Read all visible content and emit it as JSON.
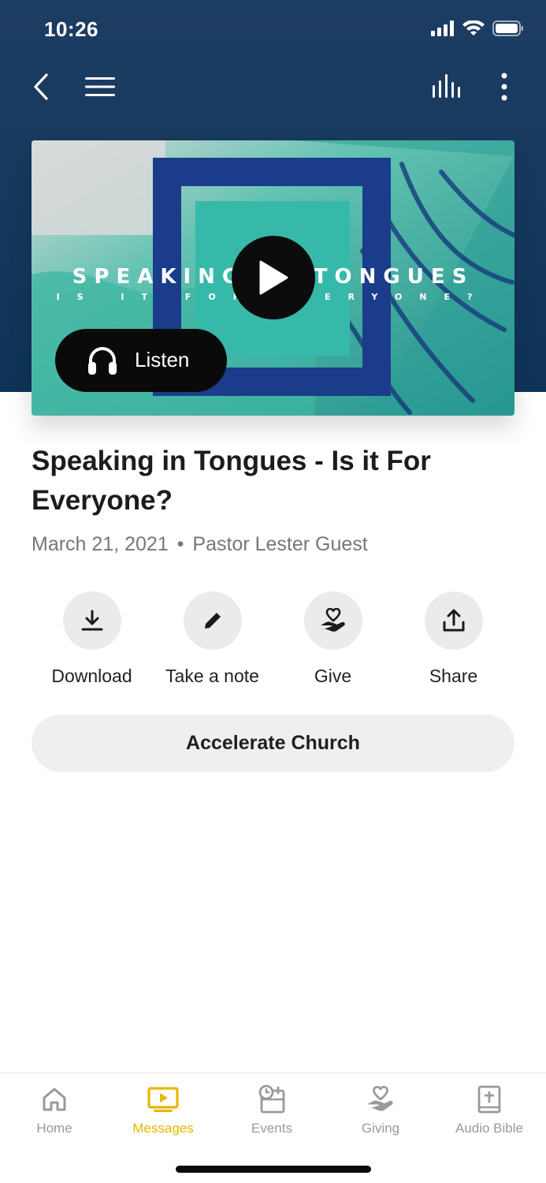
{
  "status": {
    "time": "10:26"
  },
  "message": {
    "artwork_title": "SPEAKING IN TONGUES",
    "artwork_subtitle": "IS IT FOR EVERYONE?",
    "listen_label": "Listen",
    "title": "Speaking in Tongues - Is it For Everyone?",
    "date": "March 21, 2021",
    "separator": "•",
    "speaker": "Pastor Lester Guest"
  },
  "actions": [
    {
      "label": "Download",
      "icon": "download-icon"
    },
    {
      "label": "Take a note",
      "icon": "pencil-icon"
    },
    {
      "label": "Give",
      "icon": "heart-hand-icon"
    },
    {
      "label": "Share",
      "icon": "share-icon"
    }
  ],
  "church_button": {
    "label": "Accelerate Church"
  },
  "tabs": [
    {
      "label": "Home",
      "icon": "home-icon",
      "active": false
    },
    {
      "label": "Messages",
      "icon": "play-screen-icon",
      "active": true
    },
    {
      "label": "Events",
      "icon": "calendar-clock-icon",
      "active": false
    },
    {
      "label": "Giving",
      "icon": "heart-hand-icon",
      "active": false
    },
    {
      "label": "Audio Bible",
      "icon": "bible-icon",
      "active": false
    }
  ],
  "colors": {
    "header_bg": "#173a5e",
    "accent_active": "#e9b600",
    "art_teal": "#3fb5a3",
    "art_navy": "#1a3a7a"
  }
}
